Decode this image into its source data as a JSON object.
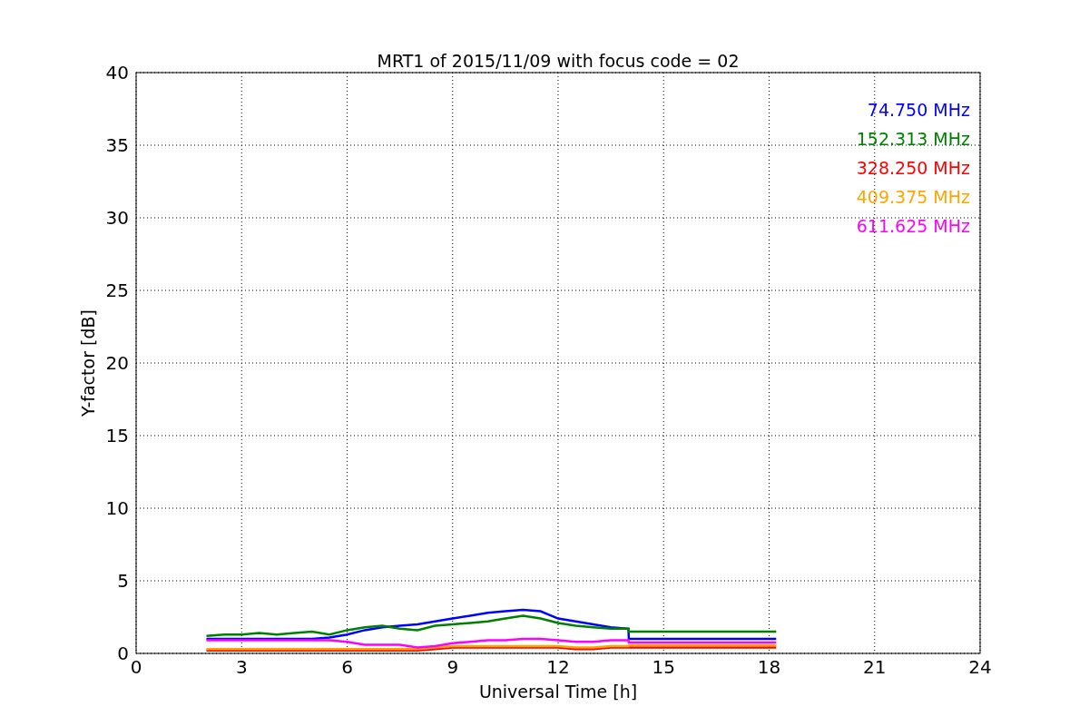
{
  "figure": {
    "chart_data": {
      "type": "line",
      "title": "MRT1 of 2015/11/09 with focus code = 02",
      "xlabel": "Universal Time [h]",
      "ylabel": "Y-factor [dB]",
      "grid": true,
      "x": [
        2,
        2.5,
        3,
        3.5,
        4,
        4.5,
        5,
        5.5,
        6,
        6.5,
        7,
        7.5,
        8,
        8.5,
        9,
        9.5,
        10,
        10.5,
        11,
        11.5,
        12,
        12.5,
        13,
        13.5,
        14,
        14.01,
        18.2
      ],
      "series": [
        {
          "name": "74.750 MHz",
          "color": "#0000ff",
          "values": [
            1.0,
            1.0,
            1.0,
            1.0,
            1.0,
            1.0,
            1.0,
            1.1,
            1.3,
            1.6,
            1.8,
            1.9,
            2.0,
            2.2,
            2.4,
            2.6,
            2.8,
            2.9,
            3.0,
            2.9,
            2.4,
            2.2,
            2.0,
            1.8,
            1.7,
            1.0,
            1.0
          ]
        },
        {
          "name": "152.313 MHz",
          "color": "#008000",
          "values": [
            1.2,
            1.3,
            1.3,
            1.4,
            1.3,
            1.4,
            1.5,
            1.3,
            1.6,
            1.8,
            1.9,
            1.7,
            1.6,
            1.9,
            2.0,
            2.1,
            2.2,
            2.4,
            2.6,
            2.4,
            2.1,
            1.9,
            1.8,
            1.7,
            1.7,
            1.5,
            1.5
          ]
        },
        {
          "name": "328.250 MHz",
          "color": "#ff0000",
          "values": [
            0.2,
            0.2,
            0.2,
            0.2,
            0.2,
            0.2,
            0.2,
            0.2,
            0.2,
            0.2,
            0.2,
            0.2,
            0.2,
            0.3,
            0.4,
            0.4,
            0.4,
            0.4,
            0.4,
            0.4,
            0.4,
            0.3,
            0.3,
            0.4,
            0.4,
            0.4,
            0.4
          ]
        },
        {
          "name": "409.375 MHz",
          "color": "#ffa500",
          "values": [
            0.3,
            0.3,
            0.3,
            0.3,
            0.3,
            0.3,
            0.3,
            0.3,
            0.3,
            0.3,
            0.3,
            0.3,
            0.3,
            0.4,
            0.5,
            0.5,
            0.5,
            0.5,
            0.5,
            0.5,
            0.5,
            0.4,
            0.4,
            0.5,
            0.5,
            0.55,
            0.55
          ]
        },
        {
          "name": "611.625 MHz",
          "color": "#ff00ff",
          "values": [
            0.9,
            0.9,
            0.9,
            0.9,
            0.9,
            0.9,
            0.9,
            0.9,
            0.8,
            0.6,
            0.6,
            0.6,
            0.4,
            0.5,
            0.7,
            0.8,
            0.9,
            0.9,
            1.0,
            1.0,
            0.9,
            0.8,
            0.8,
            0.9,
            0.9,
            0.75,
            0.75
          ]
        }
      ],
      "xlim": [
        0,
        24
      ],
      "ylim": [
        0,
        40
      ],
      "xticks": [
        0,
        3,
        6,
        9,
        12,
        15,
        18,
        21,
        24
      ],
      "yticks": [
        0,
        5,
        10,
        15,
        20,
        25,
        30,
        35,
        40
      ]
    }
  }
}
